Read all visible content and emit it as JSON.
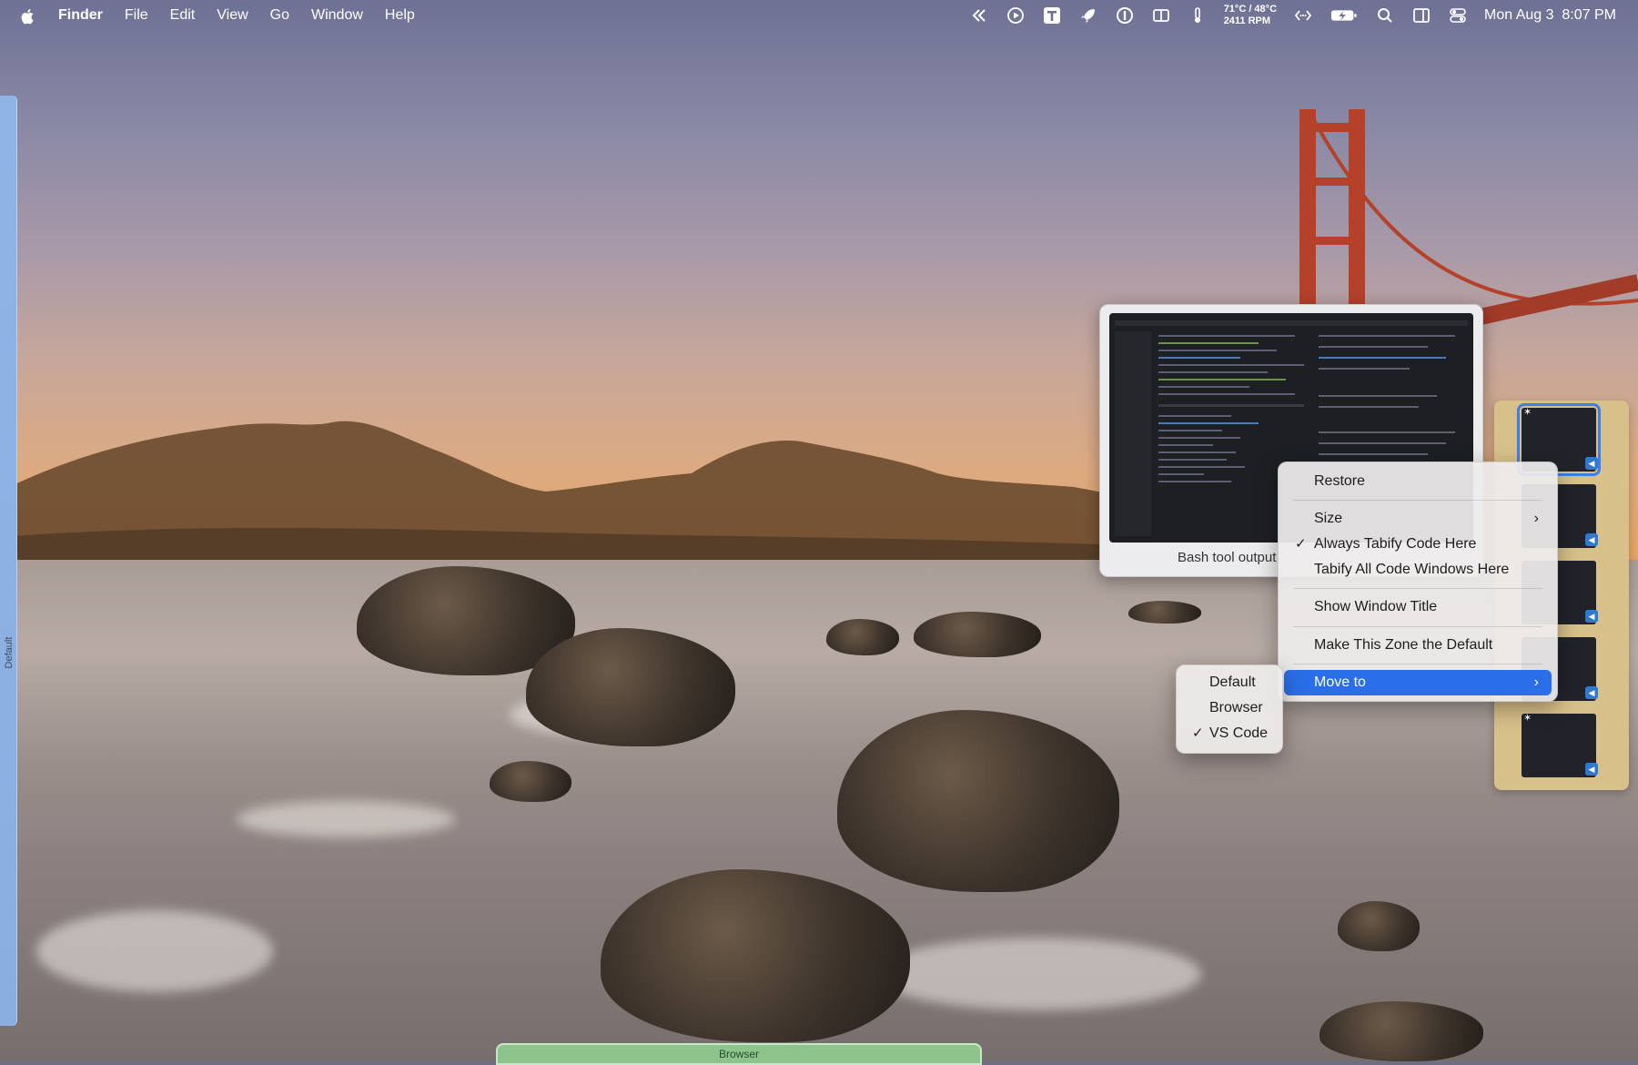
{
  "menubar": {
    "app_name": "Finder",
    "menus": [
      "File",
      "Edit",
      "View",
      "Go",
      "Window",
      "Help"
    ],
    "status_icons": [
      "chevrons-left-icon",
      "play-circle-icon",
      "text-t-icon",
      "rocket-icon",
      "1password-icon",
      "split-view-icon",
      "thermometer-icon",
      "code-brackets-icon",
      "battery-charging-icon",
      "search-icon",
      "sidebar-icon",
      "control-center-icon"
    ],
    "temperature": "71°C / 48°C",
    "fan_speed": "2411 RPM",
    "date": "Mon Aug 3",
    "time": "8:07 PM"
  },
  "zones": {
    "left_label": "Default",
    "bottom_label": "Browser"
  },
  "preview": {
    "caption": "Bash tool output"
  },
  "context_menu": {
    "items": [
      {
        "label": "Restore",
        "checked": false,
        "submenu": false
      },
      {
        "label": "Size",
        "checked": false,
        "submenu": true
      },
      {
        "label": "Always Tabify Code Here",
        "checked": true,
        "submenu": false
      },
      {
        "label": "Tabify All Code Windows Here",
        "checked": false,
        "submenu": false
      },
      {
        "label": "Show Window Title",
        "checked": false,
        "submenu": false
      },
      {
        "label": "Make This Zone the Default",
        "checked": false,
        "submenu": false
      },
      {
        "label": "Move to",
        "checked": false,
        "submenu": true,
        "highlighted": true
      }
    ],
    "check_glyph": "✓",
    "chevron_glyph": "›"
  },
  "move_to_submenu": {
    "items": [
      {
        "label": "Default",
        "checked": false
      },
      {
        "label": "Browser",
        "checked": false
      },
      {
        "label": "VS Code",
        "checked": true
      }
    ]
  },
  "colors": {
    "accent": "#2a6ee8",
    "left_zone": "#8fb4e6",
    "bottom_zone": "#8cc48b",
    "tab_stack": "#d8c08a"
  }
}
